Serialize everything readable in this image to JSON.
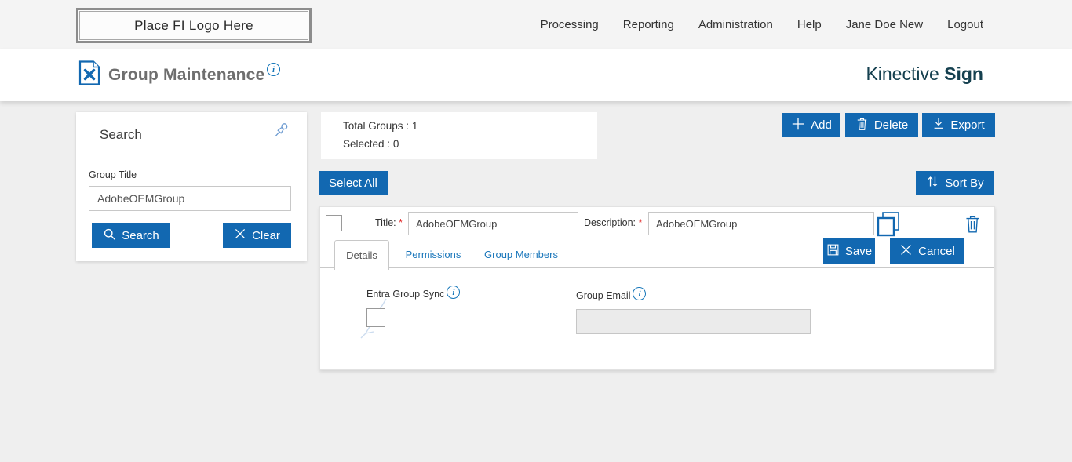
{
  "colors": {
    "primary": "#1268b1",
    "link_blue": "#1b77bb",
    "brand_teal": "#15404f",
    "required_red": "#e02020"
  },
  "topbar": {
    "logo_text": "Place FI Logo Here",
    "nav": [
      "Processing",
      "Reporting",
      "Administration",
      "Help",
      "Jane Doe New",
      "Logout"
    ]
  },
  "header": {
    "page_title": "Group Maintenance",
    "brand_name": "Kinective",
    "brand_product": "Sign"
  },
  "search_panel": {
    "title": "Search",
    "field_label": "Group Title",
    "field_value": "AdobeOEMGroup",
    "search_button": "Search",
    "clear_button": "Clear"
  },
  "summary": {
    "total_label": "Total Groups :",
    "total_value": "1",
    "selected_label": "Selected :",
    "selected_value": "0"
  },
  "toolbar": {
    "add": "Add",
    "delete": "Delete",
    "export": "Export",
    "select_all": "Select All",
    "sort_by": "Sort By"
  },
  "group_editor": {
    "title_label": "Title:",
    "required_marker": "*",
    "title_value": "AdobeOEMGroup",
    "description_label": "Description:",
    "description_value": "AdobeOEMGroup",
    "tabs": [
      {
        "label": "Details"
      },
      {
        "label": "Permissions"
      },
      {
        "label": "Group Members"
      }
    ],
    "save_button": "Save",
    "cancel_button": "Cancel",
    "details": {
      "entra_label": "Entra Group Sync",
      "email_label": "Group Email",
      "email_value": ""
    }
  },
  "icons": {
    "doc_tools": "page-with-tools",
    "info": "i-circle",
    "pin": "pushpin",
    "search": "magnifier",
    "clear": "x-mark",
    "add": "plus",
    "delete": "trash-can",
    "export": "download-arrow",
    "sort": "up-down-arrows",
    "copy": "overlapping-squares",
    "save": "floppy-disk",
    "cancel": "x-mark"
  }
}
